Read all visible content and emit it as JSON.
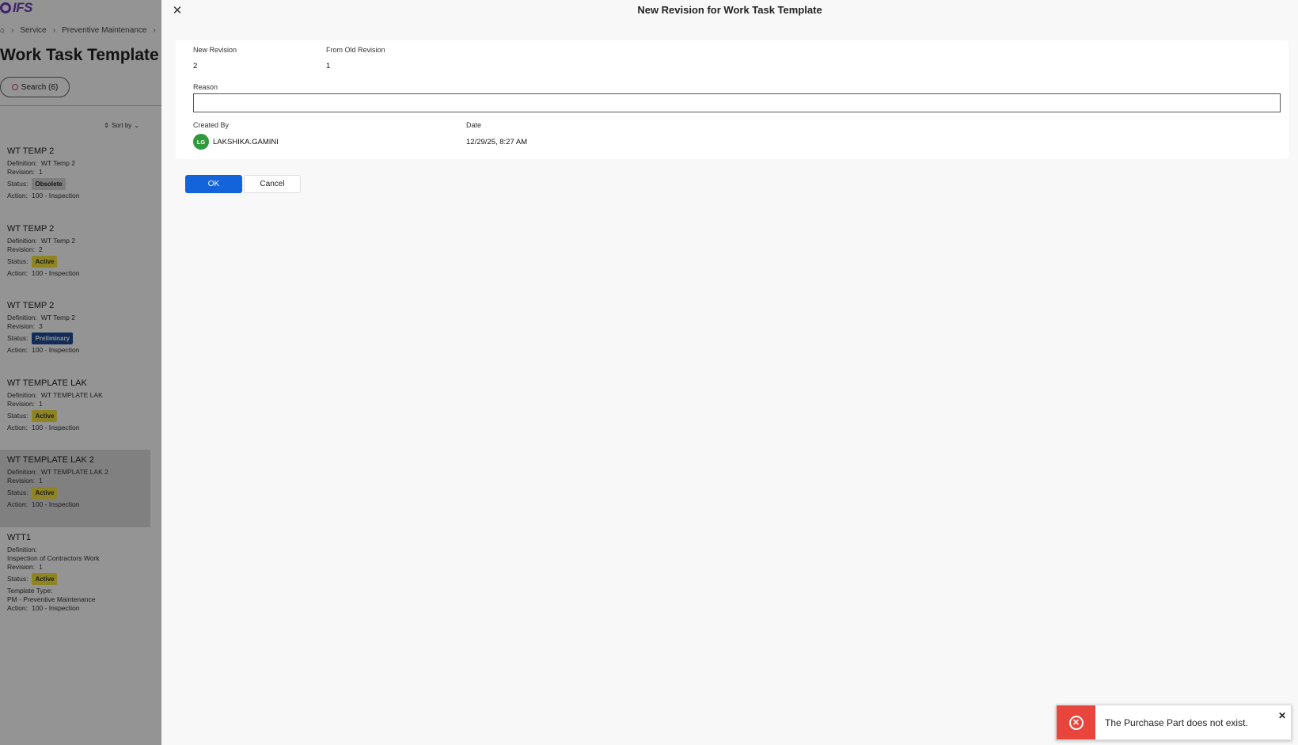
{
  "app": {
    "logo_text": "IFS"
  },
  "breadcrumb": {
    "items": [
      "Service",
      "Preventive Maintenance"
    ]
  },
  "page": {
    "title": "Work Task Template"
  },
  "search": {
    "label": "Search (6)"
  },
  "list": {
    "sort_label": "Sort by",
    "field_labels": {
      "definition": "Definition:",
      "revision": "Revision:",
      "status": "Status:",
      "action": "Action:",
      "template_type": "Template Type:"
    },
    "items": [
      {
        "title": "WT TEMP 2",
        "definition": "WT Temp 2",
        "revision": "1",
        "status": "Obsolete",
        "action": "100 - Inspection"
      },
      {
        "title": "WT TEMP 2",
        "definition": "WT Temp 2",
        "revision": "2",
        "status": "Active",
        "action": "100 - Inspection"
      },
      {
        "title": "WT TEMP 2",
        "definition": "WT Temp 2",
        "revision": "3",
        "status": "Preliminary",
        "action": "100 - Inspection"
      },
      {
        "title": "WT TEMPLATE LAK",
        "definition": "WT TEMPLATE LAK",
        "revision": "1",
        "status": "Active",
        "action": "100 - Inspection"
      },
      {
        "title": "WT TEMPLATE LAK 2",
        "definition": "WT TEMPLATE LAK 2",
        "revision": "1",
        "status": "Active",
        "action": "100 - Inspection"
      },
      {
        "title": "WTT1",
        "definition": "Inspection of Contractors Work",
        "revision": "1",
        "status": "Active",
        "template_type": "PM - Preventive Maintenance",
        "action": "100 - Inspection"
      }
    ]
  },
  "dialog": {
    "title": "New Revision for Work Task Template",
    "new_revision_label": "New Revision",
    "new_revision_value": "2",
    "from_old_revision_label": "From Old Revision",
    "from_old_revision_value": "1",
    "reason_label": "Reason",
    "reason_value": "",
    "created_by_label": "Created By",
    "created_by_initials": "LG",
    "created_by_value": "LAKSHIKA.GAMINI",
    "date_label": "Date",
    "date_value": "12/29/25, 8:27 AM",
    "ok_label": "OK",
    "cancel_label": "Cancel"
  },
  "toast": {
    "message": "The Purchase Part does not exist."
  },
  "colors": {
    "primary": "#1363db",
    "error": "#e8453c",
    "active_badge": "#f5e63c",
    "preliminary_badge": "#1f4a9a",
    "avatar": "#2e9a3a"
  }
}
